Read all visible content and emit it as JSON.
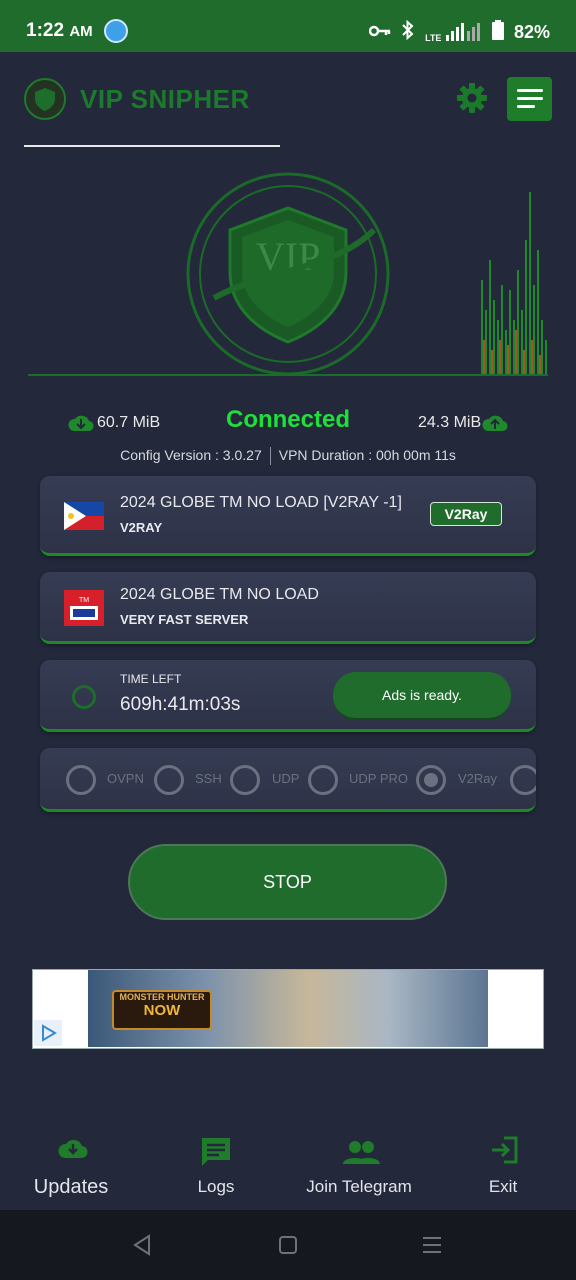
{
  "status_bar": {
    "time": "1:22",
    "ampm": "AM",
    "battery": "82%",
    "network": "LTE"
  },
  "header": {
    "app_title": "VIP SNIPHER",
    "logo_text": "VIP"
  },
  "stats": {
    "download": "60.7 MiB",
    "upload": "24.3 MiB",
    "status": "Connected",
    "config_version": "Config Version : 3.0.27",
    "vpn_duration": "VPN Duration : 00h 00m 11s"
  },
  "server_card": {
    "title": "2024 GLOBE TM NO LOAD [V2RAY -1]",
    "subtitle": "V2RAY",
    "badge": "V2Ray"
  },
  "payload_card": {
    "title": "2024 GLOBE TM NO LOAD",
    "subtitle": "VERY FAST SERVER"
  },
  "time_card": {
    "label": "TIME LEFT",
    "value": "609h:41m:03s",
    "ads_button": "Ads is ready."
  },
  "protocols": {
    "items": [
      "OVPN",
      "SSH",
      "UDP",
      "UDP PRO",
      "V2Ray"
    ],
    "selected": "V2Ray"
  },
  "stop_button": "STOP",
  "ad": {
    "game_line1": "MONSTER HUNTER",
    "game_line2": "NOW"
  },
  "bottom_nav": {
    "updates": "Updates",
    "logs": "Logs",
    "telegram": "Join Telegram",
    "exit": "Exit"
  },
  "colors": {
    "background": "#23283b",
    "accent": "#1f6c2c",
    "connected": "#1ee03a"
  }
}
